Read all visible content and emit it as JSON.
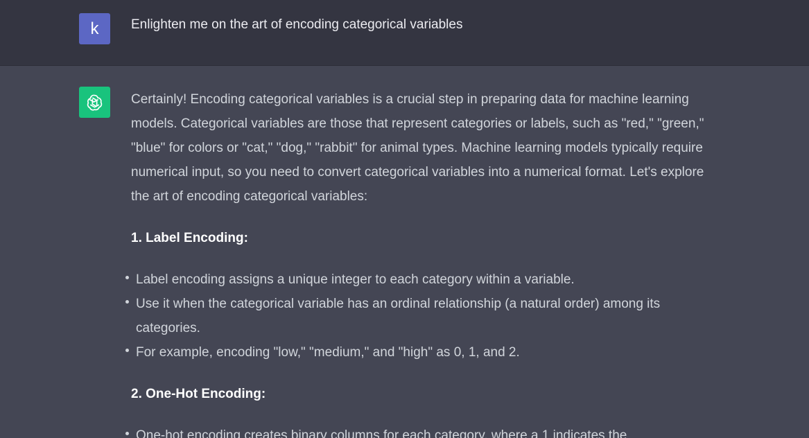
{
  "user": {
    "avatar_letter": "k",
    "message": "Enlighten me on the art of encoding categorical variables"
  },
  "assistant": {
    "avatar_icon": "openai-logo-icon",
    "intro": "Certainly! Encoding categorical variables is a crucial step in preparing data for machine learning models. Categorical variables are those that represent categories or labels, such as \"red,\" \"green,\" \"blue\" for colors or \"cat,\" \"dog,\" \"rabbit\" for animal types. Machine learning models typically require numerical input, so you need to convert categorical variables into a numerical format. Let's explore the art of encoding categorical variables:",
    "sections": [
      {
        "heading": "1. Label Encoding:",
        "bullets": [
          "Label encoding assigns a unique integer to each category within a variable.",
          "Use it when the categorical variable has an ordinal relationship (a natural order) among its categories.",
          "For example, encoding \"low,\" \"medium,\" and \"high\" as 0, 1, and 2."
        ]
      },
      {
        "heading": "2. One-Hot Encoding:",
        "bullets": [
          "One-hot encoding creates binary columns for each category, where a 1 indicates the"
        ]
      }
    ]
  },
  "colors": {
    "user_bg": "#343541",
    "assistant_bg": "#444654",
    "user_avatar": "#5c67c4",
    "assistant_avatar": "#19c37d"
  }
}
